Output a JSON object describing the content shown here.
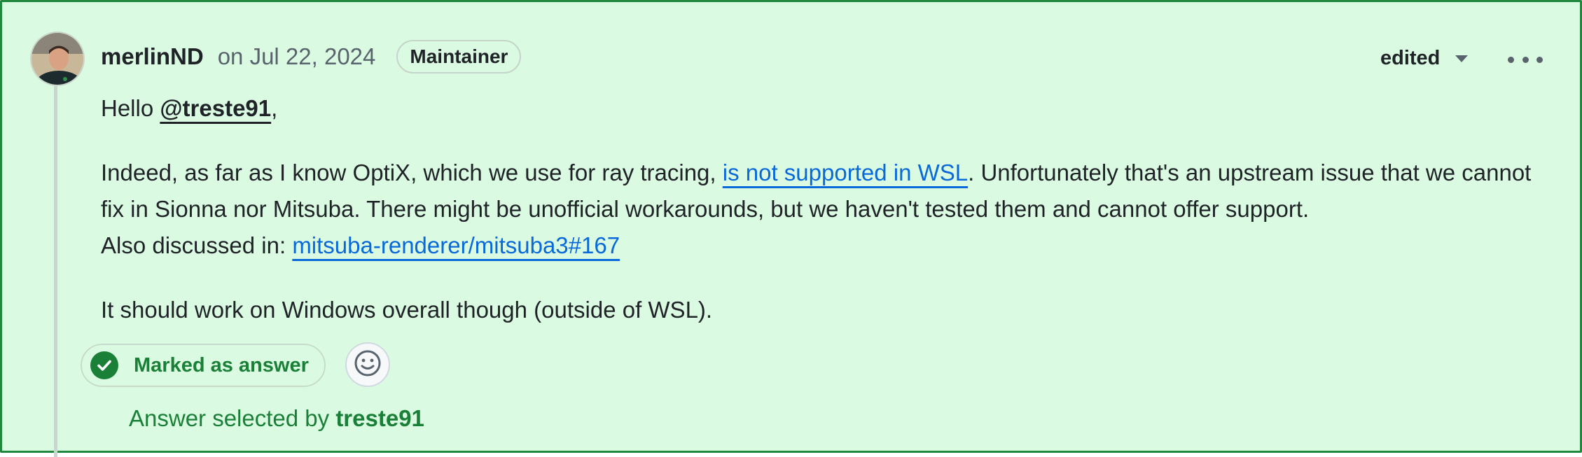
{
  "comment": {
    "author": "merlinND",
    "date": "on Jul 22, 2024",
    "role_badge": "Maintainer",
    "edited_label": "edited",
    "greeting": {
      "prefix": "Hello ",
      "mention": "@treste91",
      "suffix": ","
    },
    "paragraph2": {
      "text1": "Indeed, as far as I know OptiX, which we use for ray tracing, ",
      "link1": "is not supported in WSL",
      "text2": ". Unfortunately that's an upstream issue that we cannot fix in Sionna nor Mitsuba. There might be unofficial workarounds, but we haven't tested them and cannot offer support.",
      "text3": "Also discussed in: ",
      "link2": "mitsuba-renderer/mitsuba3#167"
    },
    "paragraph3": "It should work on Windows overall though (outside of WSL)."
  },
  "answer": {
    "marked_label": "Marked as answer",
    "selected_prefix": "Answer selected by ",
    "selected_user": "treste91"
  },
  "icons": {
    "check": "check-circle-icon",
    "emoji": "smiley-icon",
    "more": "kebab-horizontal-icon",
    "caret": "triangle-down-icon"
  },
  "colors": {
    "background": "#dafbe1",
    "border": "#1f883d",
    "accent_green": "#1a7f37",
    "link_blue": "#0969da"
  }
}
